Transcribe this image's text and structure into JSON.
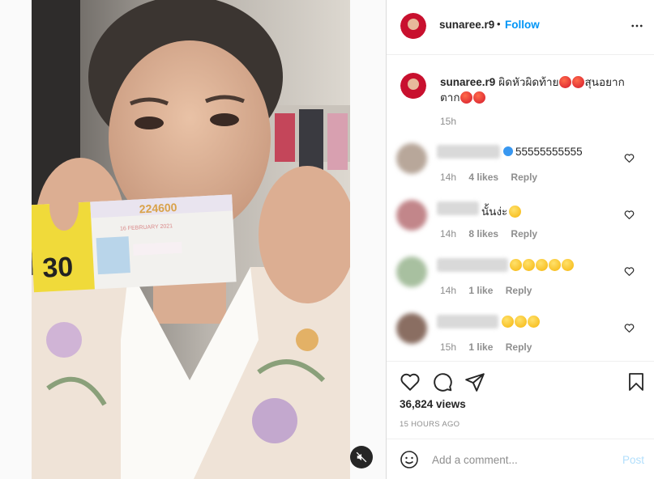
{
  "post": {
    "username": "sunaree.r9",
    "dot": "•",
    "follow_label": "Follow",
    "caption_text": "ผิดหัวผิดท้าย",
    "caption_text_2": "สุนอยาก",
    "caption_text_3": "ตาก",
    "caption_time": "15h",
    "views": "36,824 views",
    "posted_ago": "15 HOURS AGO"
  },
  "comments": [
    {
      "text": "55555555555",
      "time": "14h",
      "likes": "4 likes",
      "reply": "Reply",
      "verified": true
    },
    {
      "text": "นั้นง่ะ",
      "time": "14h",
      "likes": "8 likes",
      "reply": "Reply",
      "verified": false
    },
    {
      "text": "",
      "time": "14h",
      "likes": "1 like",
      "reply": "Reply",
      "verified": false
    },
    {
      "text": "",
      "time": "15h",
      "likes": "1 like",
      "reply": "Reply",
      "verified": false
    }
  ],
  "add_comment": {
    "placeholder": "Add a comment...",
    "post_label": "Post"
  },
  "ticket": {
    "number": "224600",
    "price": "30",
    "date_en": "16 FEBRUARY 2021"
  },
  "icons": [
    "more-icon",
    "heart-icon",
    "comment-icon",
    "share-icon",
    "bookmark-icon",
    "emoji-icon",
    "mute-icon"
  ],
  "colors": {
    "accent": "#0095f6",
    "post_disabled": "#b2dffc",
    "muted_text": "#8e8e8e"
  }
}
